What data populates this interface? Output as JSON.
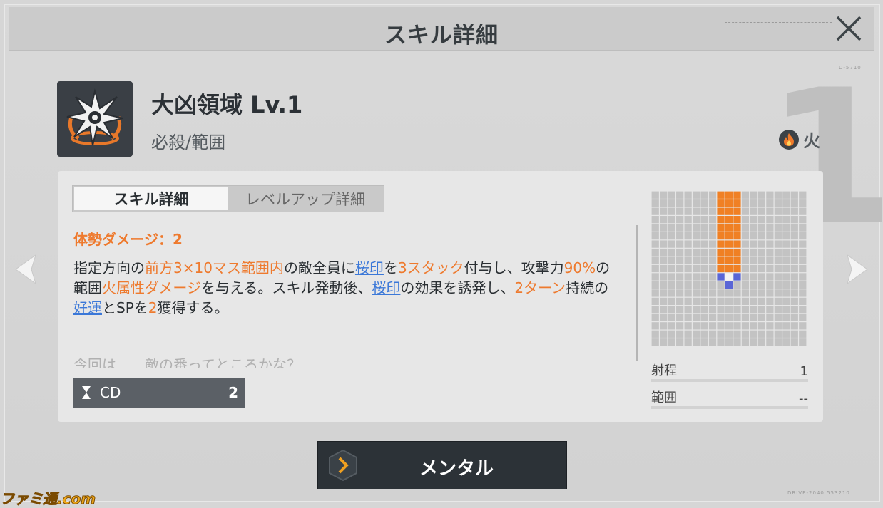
{
  "header": {
    "title": "スキル詳細"
  },
  "skill": {
    "name": "大凶領域 Lv.1",
    "type": "必殺/範囲",
    "element": "火",
    "level_mark": "1"
  },
  "deco": {
    "code_top": "D-5710",
    "code_bottom": "DRIVE-2040 553210"
  },
  "tabs": [
    {
      "label": "スキル詳細",
      "active": true
    },
    {
      "label": "レベルアップ詳細",
      "active": false
    }
  ],
  "stance_damage": "体勢ダメージ：2",
  "description": {
    "segments": [
      {
        "t": "指定方向の",
        "s": "n"
      },
      {
        "t": "前方3×10マス範囲内",
        "s": "h"
      },
      {
        "t": "の敵全員に",
        "s": "n"
      },
      {
        "t": "桜印",
        "s": "l"
      },
      {
        "t": "を",
        "s": "n"
      },
      {
        "t": "3スタック",
        "s": "h"
      },
      {
        "t": "付与し、攻撃力",
        "s": "n"
      },
      {
        "t": "90%",
        "s": "h"
      },
      {
        "t": "の範囲",
        "s": "n"
      },
      {
        "t": "火属性ダメージ",
        "s": "h"
      },
      {
        "t": "を与える。スキル発動後、",
        "s": "n"
      },
      {
        "t": "桜印",
        "s": "l"
      },
      {
        "t": "の効果を誘発し、",
        "s": "n"
      },
      {
        "t": "2ターン",
        "s": "h"
      },
      {
        "t": "持続の",
        "s": "n"
      },
      {
        "t": "好運",
        "s": "l"
      },
      {
        "t": "とSPを",
        "s": "n"
      },
      {
        "t": "2",
        "s": "h"
      },
      {
        "t": "獲得する。",
        "s": "n"
      }
    ]
  },
  "flavor": "今回は……敵の番ってところかな？",
  "cooldown": {
    "label": "CD",
    "value": "2"
  },
  "range_grid": {
    "cols": 19,
    "rows": 19,
    "origin": {
      "col": 9,
      "row": 10
    },
    "area_cols": [
      8,
      9,
      10
    ],
    "area_rows": [
      0,
      1,
      2,
      3,
      4,
      5,
      6,
      7,
      8,
      9
    ],
    "colors": {
      "cell": "#c3c3c3",
      "area": "#f08024",
      "origin": "#5a66d6"
    }
  },
  "stats": [
    {
      "label": "射程",
      "value": "1"
    },
    {
      "label": "範囲",
      "value": "--"
    }
  ],
  "action_button": {
    "label": "メンタル"
  },
  "watermark": "ファミ通.com",
  "colors": {
    "accent": "#ee7a2e",
    "link": "#3b78d8",
    "panel": "#e7e7e7",
    "button": "#2c3237"
  }
}
